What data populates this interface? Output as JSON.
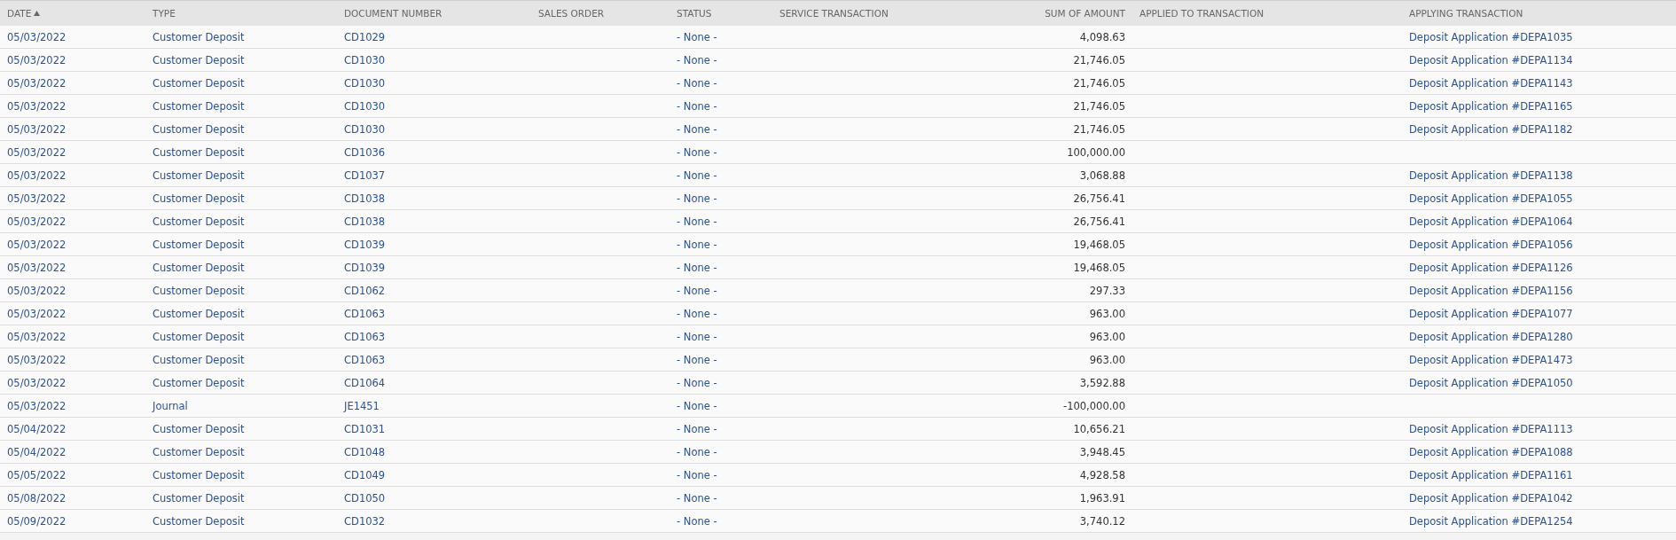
{
  "table": {
    "columns": [
      {
        "label": "DATE",
        "sorted": true
      },
      {
        "label": "TYPE",
        "sorted": false
      },
      {
        "label": "DOCUMENT NUMBER",
        "sorted": false
      },
      {
        "label": "SALES ORDER",
        "sorted": false
      },
      {
        "label": "STATUS",
        "sorted": false
      },
      {
        "label": "SERVICE TRANSACTION",
        "sorted": false
      },
      {
        "label": "SUM OF AMOUNT",
        "sorted": false
      },
      {
        "label": "APPLIED TO TRANSACTION",
        "sorted": false
      },
      {
        "label": "APPLYING TRANSACTION",
        "sorted": false
      }
    ],
    "rows": [
      {
        "date": "05/03/2022",
        "type": "Customer Deposit",
        "document_number": "CD1029",
        "status": "- None -",
        "sum_of_amount": "4,098.63",
        "applying_transaction": "Deposit Application #DEPA1035"
      },
      {
        "date": "05/03/2022",
        "type": "Customer Deposit",
        "document_number": "CD1030",
        "status": "- None -",
        "sum_of_amount": "21,746.05",
        "applying_transaction": "Deposit Application #DEPA1134"
      },
      {
        "date": "05/03/2022",
        "type": "Customer Deposit",
        "document_number": "CD1030",
        "status": "- None -",
        "sum_of_amount": "21,746.05",
        "applying_transaction": "Deposit Application #DEPA1143"
      },
      {
        "date": "05/03/2022",
        "type": "Customer Deposit",
        "document_number": "CD1030",
        "status": "- None -",
        "sum_of_amount": "21,746.05",
        "applying_transaction": "Deposit Application #DEPA1165"
      },
      {
        "date": "05/03/2022",
        "type": "Customer Deposit",
        "document_number": "CD1030",
        "status": "- None -",
        "sum_of_amount": "21,746.05",
        "applying_transaction": "Deposit Application #DEPA1182"
      },
      {
        "date": "05/03/2022",
        "type": "Customer Deposit",
        "document_number": "CD1036",
        "status": "- None -",
        "sum_of_amount": "100,000.00"
      },
      {
        "date": "05/03/2022",
        "type": "Customer Deposit",
        "document_number": "CD1037",
        "status": "- None -",
        "sum_of_amount": "3,068.88",
        "applying_transaction": "Deposit Application #DEPA1138"
      },
      {
        "date": "05/03/2022",
        "type": "Customer Deposit",
        "document_number": "CD1038",
        "status": "- None -",
        "sum_of_amount": "26,756.41",
        "applying_transaction": "Deposit Application #DEPA1055"
      },
      {
        "date": "05/03/2022",
        "type": "Customer Deposit",
        "document_number": "CD1038",
        "status": "- None -",
        "sum_of_amount": "26,756.41",
        "applying_transaction": "Deposit Application #DEPA1064"
      },
      {
        "date": "05/03/2022",
        "type": "Customer Deposit",
        "document_number": "CD1039",
        "status": "- None -",
        "sum_of_amount": "19,468.05",
        "applying_transaction": "Deposit Application #DEPA1056"
      },
      {
        "date": "05/03/2022",
        "type": "Customer Deposit",
        "document_number": "CD1039",
        "status": "- None -",
        "sum_of_amount": "19,468.05",
        "applying_transaction": "Deposit Application #DEPA1126"
      },
      {
        "date": "05/03/2022",
        "type": "Customer Deposit",
        "document_number": "CD1062",
        "status": "- None -",
        "sum_of_amount": "297.33",
        "applying_transaction": "Deposit Application #DEPA1156"
      },
      {
        "date": "05/03/2022",
        "type": "Customer Deposit",
        "document_number": "CD1063",
        "status": "- None -",
        "sum_of_amount": "963.00",
        "applying_transaction": "Deposit Application #DEPA1077"
      },
      {
        "date": "05/03/2022",
        "type": "Customer Deposit",
        "document_number": "CD1063",
        "status": "- None -",
        "sum_of_amount": "963.00",
        "applying_transaction": "Deposit Application #DEPA1280"
      },
      {
        "date": "05/03/2022",
        "type": "Customer Deposit",
        "document_number": "CD1063",
        "status": "- None -",
        "sum_of_amount": "963.00",
        "applying_transaction": "Deposit Application #DEPA1473"
      },
      {
        "date": "05/03/2022",
        "type": "Customer Deposit",
        "document_number": "CD1064",
        "status": "- None -",
        "sum_of_amount": "3,592.88",
        "applying_transaction": "Deposit Application #DEPA1050"
      },
      {
        "date": "05/03/2022",
        "type": "Journal",
        "document_number": "JE1451",
        "status": "- None -",
        "sum_of_amount": "-100,000.00"
      },
      {
        "date": "05/04/2022",
        "type": "Customer Deposit",
        "document_number": "CD1031",
        "status": "- None -",
        "sum_of_amount": "10,656.21",
        "applying_transaction": "Deposit Application #DEPA1113"
      },
      {
        "date": "05/04/2022",
        "type": "Customer Deposit",
        "document_number": "CD1048",
        "status": "- None -",
        "sum_of_amount": "3,948.45",
        "applying_transaction": "Deposit Application #DEPA1088"
      },
      {
        "date": "05/05/2022",
        "type": "Customer Deposit",
        "document_number": "CD1049",
        "status": "- None -",
        "sum_of_amount": "4,928.58",
        "applying_transaction": "Deposit Application #DEPA1161"
      },
      {
        "date": "05/08/2022",
        "type": "Customer Deposit",
        "document_number": "CD1050",
        "status": "- None -",
        "sum_of_amount": "1,963.91",
        "applying_transaction": "Deposit Application #DEPA1042"
      },
      {
        "date": "05/09/2022",
        "type": "Customer Deposit",
        "document_number": "CD1032",
        "status": "- None -",
        "sum_of_amount": "3,740.12",
        "applying_transaction": "Deposit Application #DEPA1254"
      }
    ]
  }
}
